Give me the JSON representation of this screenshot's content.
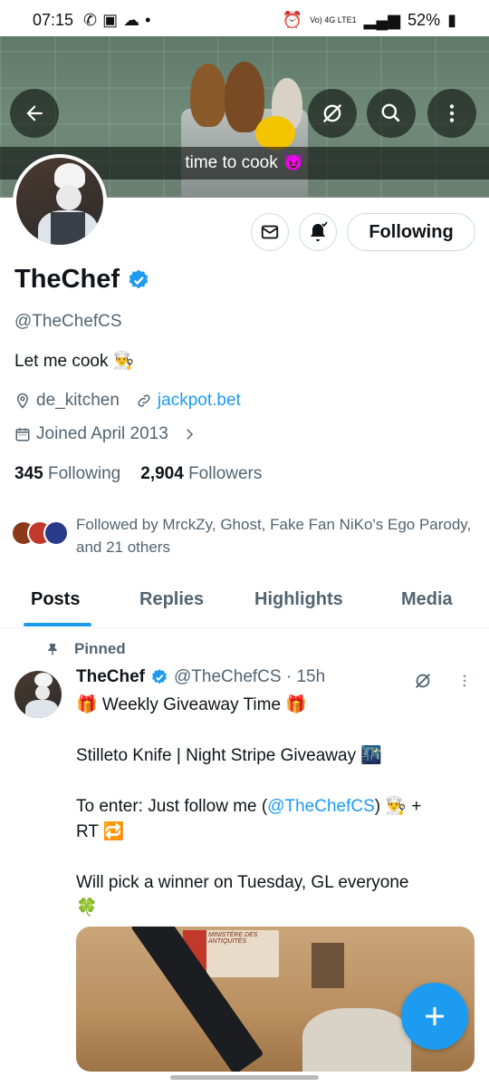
{
  "status_bar": {
    "time": "07:15",
    "network": "Vo) 4G LTE1",
    "battery": "52%"
  },
  "banner": {
    "caption": "time to cook 😈"
  },
  "profile": {
    "display_name": "TheChef",
    "handle": "@TheChefCS",
    "bio": "Let me cook 👨‍🍳",
    "location": "de_kitchen",
    "website": "jackpot.bet",
    "joined": "Joined April 2013",
    "following_count": "345",
    "following_label": "Following",
    "followers_count": "2,904",
    "followers_label": "Followers",
    "followed_by": "Followed by MrckZy, Ghost, Fake Fan NiKo's Ego Parody, and 21 others",
    "follow_button": "Following"
  },
  "tabs": [
    {
      "label": "Posts",
      "active": true
    },
    {
      "label": "Replies"
    },
    {
      "label": "Highlights"
    },
    {
      "label": "Media"
    }
  ],
  "post": {
    "pinned_label": "Pinned",
    "author": "TheChef",
    "meta": "@TheChefCS · 15h",
    "line1": "🎁 Weekly Giveaway Time 🎁",
    "line2": "Stilleto Knife | Night Stripe Giveaway 🌃",
    "line3_prefix": "To enter: Just follow me (",
    "line3_mention": "@TheChefCS",
    "line3_suffix": ") 👨‍🍳 +",
    "line4": "RT 🔁",
    "line5": "Will pick a winner on Tuesday, GL everyone",
    "line6": "🍀",
    "media_sign": "MINISTÈRE DES ANTIQUITÉS"
  },
  "colors": {
    "accent": "#1d9bf0",
    "text": "#0f1419",
    "secondary": "#536471"
  }
}
